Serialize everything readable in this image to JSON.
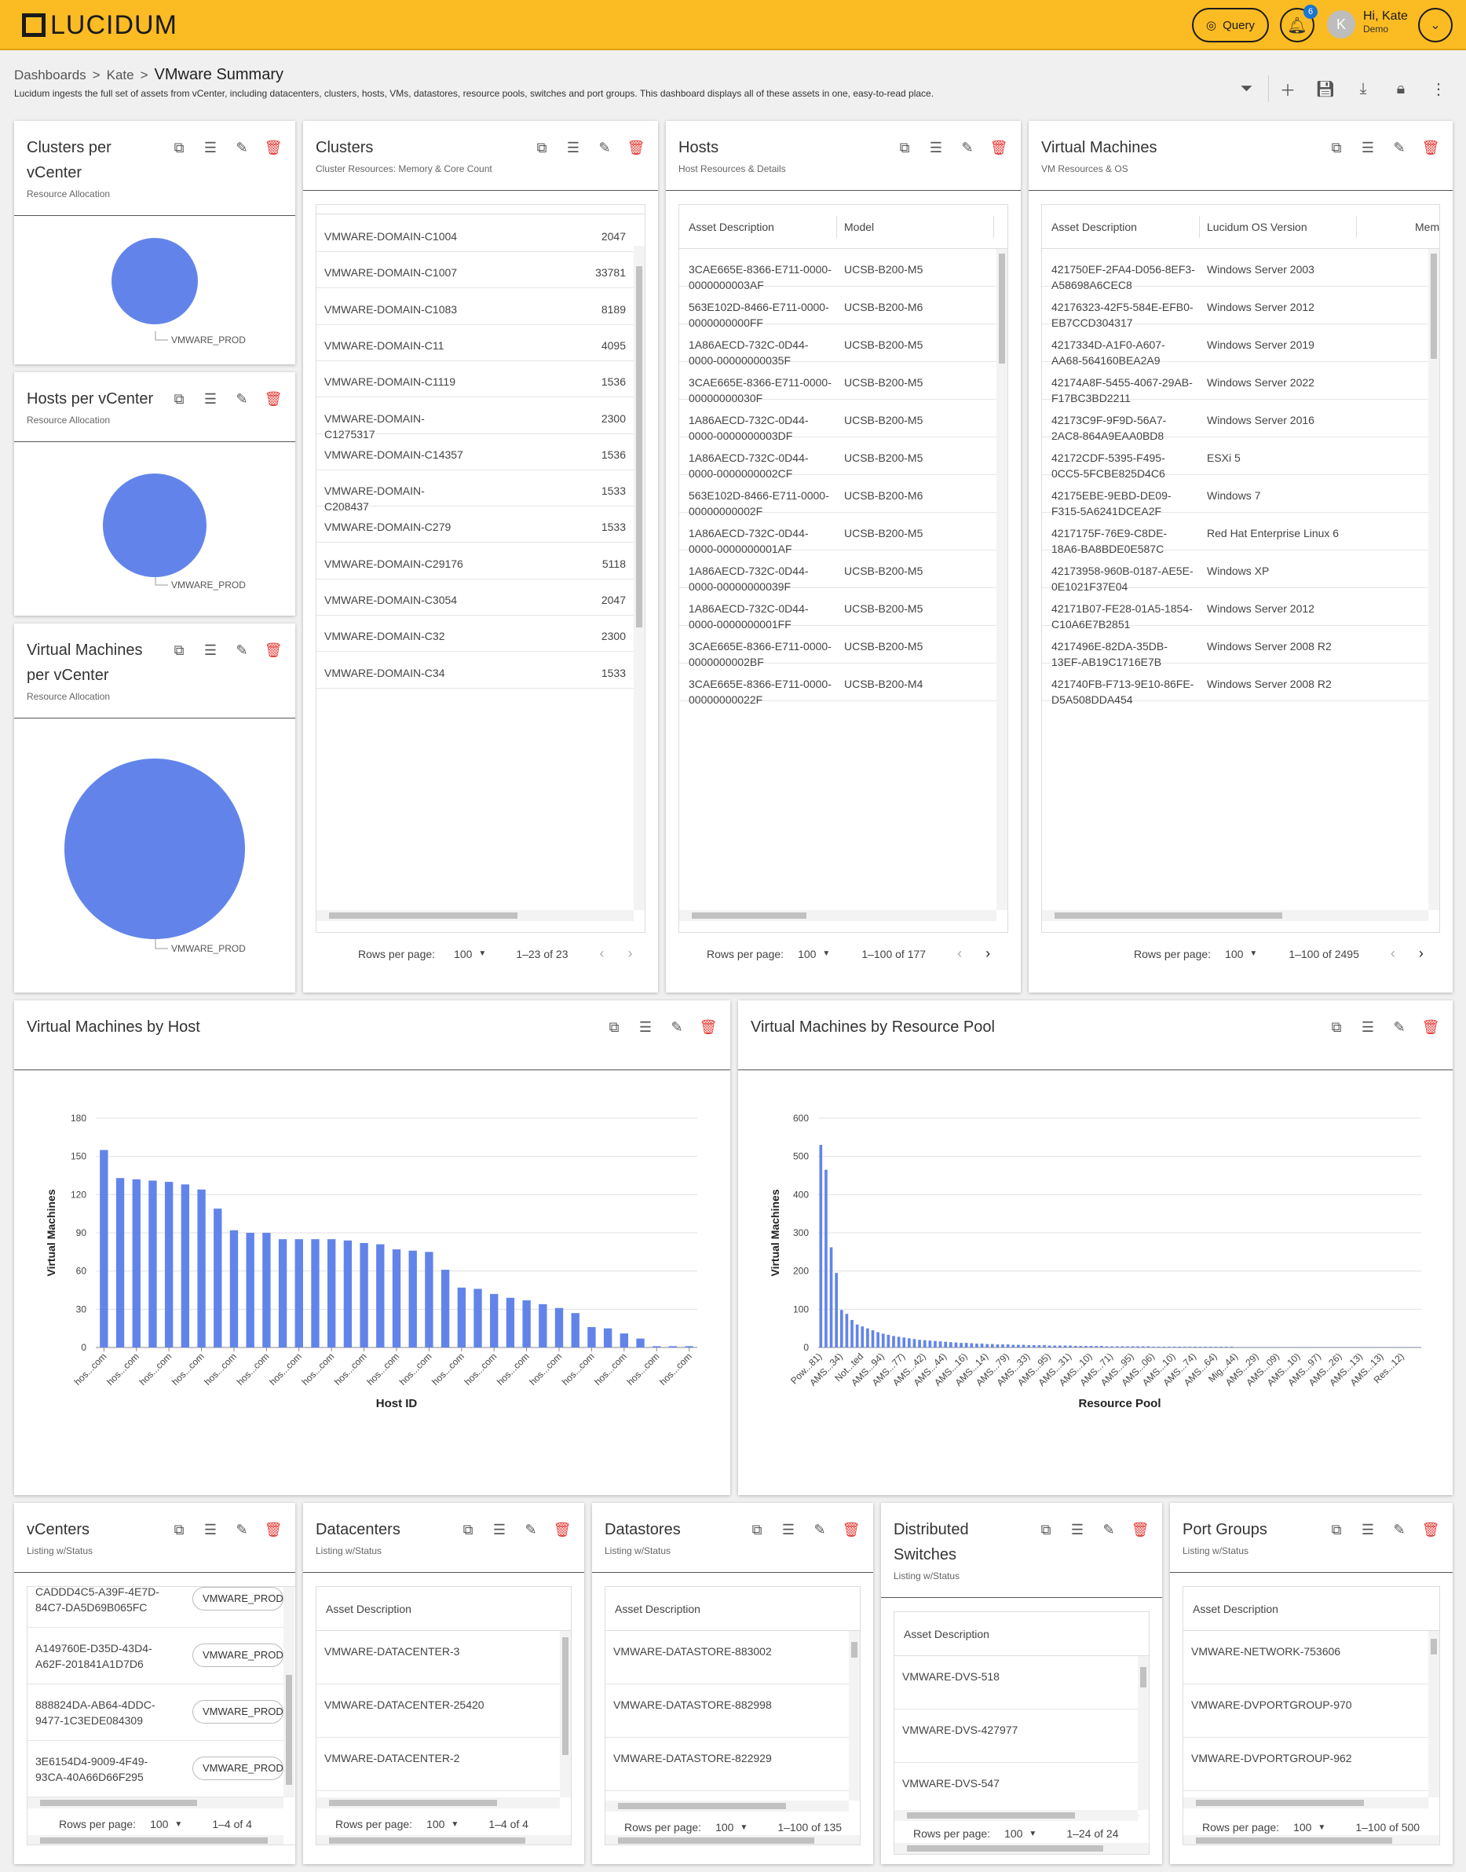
{
  "app": {
    "logo": "LUCIDUM",
    "query_label": "Query",
    "notif_count": "6",
    "avatar_initial": "K",
    "user_greeting": "Hi, Kate",
    "user_role": "Demo"
  },
  "breadcrumb": {
    "root": "Dashboards",
    "sep": ">",
    "mid": "Kate",
    "current": "VMware Summary"
  },
  "description": "Lucidum ingests the full set of assets from vCenter, including datacenters, clusters, hosts, VMs, datastores, resource pools, switches and port groups. This dashboard displays all of these assets in one, easy-to-read place.",
  "colors": {
    "accent": "#fbbb23",
    "bar": "#6284ea",
    "delete": "#e53935"
  },
  "pies": [
    {
      "title1": "Clusters per",
      "title2": "vCenter",
      "subtitle": "Resource Allocation",
      "label": "VMWARE_PROD"
    },
    {
      "title1": "Hosts per vCenter",
      "title2": "",
      "subtitle": "Resource Allocation",
      "label": "VMWARE_PROD"
    },
    {
      "title1": "Virtual Machines",
      "title2": "per vCenter",
      "subtitle": "Resource Allocation",
      "label": "VMWARE_PROD"
    }
  ],
  "clusters": {
    "title": "Clusters",
    "subtitle": "Cluster Resources: Memory & Core Count",
    "rows": [
      [
        "VMWARE-DOMAIN-C1004",
        "2047"
      ],
      [
        "VMWARE-DOMAIN-C1007",
        "33781"
      ],
      [
        "VMWARE-DOMAIN-C1083",
        "8189"
      ],
      [
        "VMWARE-DOMAIN-C11",
        "4095"
      ],
      [
        "VMWARE-DOMAIN-C1119",
        "1536"
      ],
      [
        "VMWARE-DOMAIN-\nC1275317",
        "2300"
      ],
      [
        "VMWARE-DOMAIN-C14357",
        "1536"
      ],
      [
        "VMWARE-DOMAIN-\nC208437",
        "1533"
      ],
      [
        "VMWARE-DOMAIN-C279",
        "1533"
      ],
      [
        "VMWARE-DOMAIN-C29176",
        "5118"
      ],
      [
        "VMWARE-DOMAIN-C3054",
        "2047"
      ],
      [
        "VMWARE-DOMAIN-C32",
        "2300"
      ],
      [
        "VMWARE-DOMAIN-C34",
        "1533"
      ]
    ],
    "rows_per_page_label": "Rows per page:",
    "rows_per_page": "100",
    "range": "1–23 of 23"
  },
  "hosts": {
    "title": "Hosts",
    "subtitle": "Host Resources & Details",
    "col1": "Asset Description",
    "col2": "Model",
    "rows": [
      [
        "3CAE665E-8366-E711-0000-\n0000000003AF",
        "UCSB-B200-M5"
      ],
      [
        "563E102D-8466-E711-0000-\n0000000000FF",
        "UCSB-B200-M6"
      ],
      [
        "1A86AECD-732C-0D44-\n0000-00000000035F",
        "UCSB-B200-M5"
      ],
      [
        "3CAE665E-8366-E711-0000-\n00000000030F",
        "UCSB-B200-M5"
      ],
      [
        "1A86AECD-732C-0D44-\n0000-0000000003DF",
        "UCSB-B200-M5"
      ],
      [
        "1A86AECD-732C-0D44-\n0000-0000000002CF",
        "UCSB-B200-M5"
      ],
      [
        "563E102D-8466-E711-0000-\n00000000002F",
        "UCSB-B200-M6"
      ],
      [
        "1A86AECD-732C-0D44-\n0000-0000000001AF",
        "UCSB-B200-M5"
      ],
      [
        "1A86AECD-732C-0D44-\n0000-00000000039F",
        "UCSB-B200-M5"
      ],
      [
        "1A86AECD-732C-0D44-\n0000-0000000001FF",
        "UCSB-B200-M5"
      ],
      [
        "3CAE665E-8366-E711-0000-\n0000000002BF",
        "UCSB-B200-M5"
      ],
      [
        "3CAE665E-8366-E711-0000-\n00000000022F",
        "UCSB-B200-M4"
      ]
    ],
    "rows_per_page_label": "Rows per page:",
    "rows_per_page": "100",
    "range": "1–100 of 177"
  },
  "vms": {
    "title": "Virtual Machines",
    "subtitle": "VM Resources & OS",
    "col1": "Asset Description",
    "col2": "Lucidum OS Version",
    "col3": "Mem",
    "rows": [
      [
        "421750EF-2FA4-D056-8EF3-\nA58698A6CEC8",
        "Windows Server 2003"
      ],
      [
        "42176323-42F5-584E-EFB0-\nEB7CCD304317",
        "Windows Server 2012"
      ],
      [
        "4217334D-A1F0-A607-\nAA68-564160BEA2A9",
        "Windows Server 2019"
      ],
      [
        "42174A8F-5455-4067-29AB-\nF17BC3BD2211",
        "Windows Server 2022"
      ],
      [
        "42173C9F-9F9D-56A7-\n2AC8-864A9EAA0BD8",
        "Windows Server 2016"
      ],
      [
        "42172CDF-5395-F495-\n0CC5-5FCBE825D4C6",
        "ESXi 5"
      ],
      [
        "42175EBE-9EBD-DE09-\nF315-5A6241DCEA2F",
        "Windows 7"
      ],
      [
        "4217175F-76E9-C8DE-\n18A6-BA8BDE0E587C",
        "Red Hat Enterprise Linux 6"
      ],
      [
        "42173958-960B-0187-AE5E-\n0E1021F37E04",
        "Windows XP"
      ],
      [
        "42171B07-FE28-01A5-1854-\nC10A6E7B2851",
        "Windows Server 2012"
      ],
      [
        "4217496E-82DA-35DB-\n13EF-AB19C1716E7B",
        "Windows Server 2008 R2"
      ],
      [
        "421740FB-F713-9E10-86FE-\nD5A508DDA454",
        "Windows Server 2008 R2"
      ]
    ],
    "rows_per_page_label": "Rows per page:",
    "rows_per_page": "100",
    "range": "1–100 of 2495"
  },
  "chart_data": [
    {
      "type": "bar",
      "title": "Virtual Machines by Host",
      "xlabel": "Host ID",
      "ylabel": "Virtual Machines",
      "ylim": [
        0,
        180
      ],
      "yticks": [
        0,
        30,
        60,
        90,
        120,
        150,
        180
      ],
      "tick_label": "hos...com",
      "values": [
        155,
        133,
        132,
        131,
        130,
        128,
        124,
        109,
        92,
        90,
        90,
        85,
        85,
        85,
        85,
        84,
        82,
        81,
        77,
        76,
        75,
        61,
        47,
        46,
        42,
        39,
        37,
        34,
        31,
        27,
        16,
        15,
        11,
        7,
        1,
        1,
        1
      ]
    },
    {
      "type": "bar",
      "title": "Virtual Machines by Resource Pool",
      "xlabel": "Resource Pool",
      "ylabel": "Virtual Machines",
      "ylim": [
        0,
        600
      ],
      "yticks": [
        0,
        100,
        200,
        300,
        400,
        500,
        600
      ],
      "tick_labels": [
        "Pow...81)",
        "AMS...34)",
        "Not...ted",
        "AMS...94)",
        "AMS...77)",
        "AMS...42)",
        "AMS...44)",
        "AMS...16)",
        "AMS...14)",
        "AMS...79)",
        "AMS...33)",
        "AMS...95)",
        "AMS...31)",
        "AMS...10)",
        "AMS...71)",
        "AMS...95)",
        "AMS...06)",
        "AMS...10)",
        "AMS...74)",
        "AMS...64)",
        "Mig...44)",
        "AMS...29)",
        "AMS...09)",
        "AMS...10)",
        "AMS...97)",
        "AMS...26)",
        "AMS...13)",
        "AMS...13)",
        "Res...12)"
      ],
      "values": [
        530,
        465,
        262,
        195,
        98,
        88,
        72,
        60,
        55,
        50,
        45,
        40,
        36,
        33,
        30,
        28,
        26,
        24,
        22,
        20,
        19,
        18,
        17,
        16,
        15,
        14,
        13,
        12,
        12,
        11,
        10,
        10,
        9,
        9,
        8,
        8,
        8,
        7,
        7,
        7,
        6,
        6,
        6,
        6,
        5,
        5,
        5,
        5,
        5,
        4,
        4,
        4,
        4,
        4,
        4,
        3,
        3,
        3,
        3,
        3,
        3,
        3,
        3,
        3,
        2,
        2,
        2,
        2,
        2,
        2,
        2,
        2,
        2,
        2,
        2,
        2,
        2,
        2,
        2,
        2,
        1,
        1,
        1,
        1,
        1,
        1,
        1,
        1,
        1,
        1,
        1,
        1,
        1,
        1,
        1,
        1,
        1,
        1,
        1,
        1,
        1,
        1,
        1,
        1,
        1,
        1,
        1,
        1,
        1,
        1,
        1,
        1,
        1,
        1,
        1,
        1
      ]
    }
  ],
  "vcenters": {
    "title": "vCenters",
    "subtitle": "Listing w/Status",
    "rows": [
      [
        "CADDD4C5-A39F-4E7D-\n84C7-DA5D69B065FC",
        "VMWARE_PROD"
      ],
      [
        "A149760E-D35D-43D4-\nA62F-201841A1D7D6",
        "VMWARE_PROD"
      ],
      [
        "888824DA-AB64-4DDC-\n9477-1C3EDE084309",
        "VMWARE_PROD"
      ],
      [
        "3E6154D4-9009-4F49-\n93CA-40A66D66F295",
        "VMWARE_PROD"
      ]
    ],
    "rows_per_page_label": "Rows per page:",
    "rows_per_page": "100",
    "range": "1–4 of 4"
  },
  "datacenters": {
    "title": "Datacenters",
    "subtitle": "Listing w/Status",
    "col1": "Asset Description",
    "rows": [
      "VMWARE-DATACENTER-3",
      "VMWARE-DATACENTER-25420",
      "VMWARE-DATACENTER-2"
    ],
    "rows_per_page_label": "Rows per page:",
    "rows_per_page": "100",
    "range": "1–4 of 4"
  },
  "datastores": {
    "title": "Datastores",
    "subtitle": "Listing w/Status",
    "col1": "Asset Description",
    "rows": [
      "VMWARE-DATASTORE-883002",
      "VMWARE-DATASTORE-882998",
      "VMWARE-DATASTORE-822929"
    ],
    "rows_per_page_label": "Rows per page:",
    "rows_per_page": "100",
    "range": "1–100 of 135"
  },
  "switches": {
    "title1": "Distributed",
    "title2": "Switches",
    "subtitle": "Listing w/Status",
    "col1": "Asset Description",
    "rows": [
      "VMWARE-DVS-518",
      "VMWARE-DVS-427977",
      "VMWARE-DVS-547"
    ],
    "rows_per_page_label": "Rows per page:",
    "rows_per_page": "100",
    "range": "1–24 of 24"
  },
  "portgroups": {
    "title": "Port Groups",
    "subtitle": "Listing w/Status",
    "col1": "Asset Description",
    "rows": [
      "VMWARE-NETWORK-753606",
      "VMWARE-DVPORTGROUP-970",
      "VMWARE-DVPORTGROUP-962"
    ],
    "rows_per_page_label": "Rows per page:",
    "rows_per_page": "100",
    "range": "1–100 of 500"
  }
}
